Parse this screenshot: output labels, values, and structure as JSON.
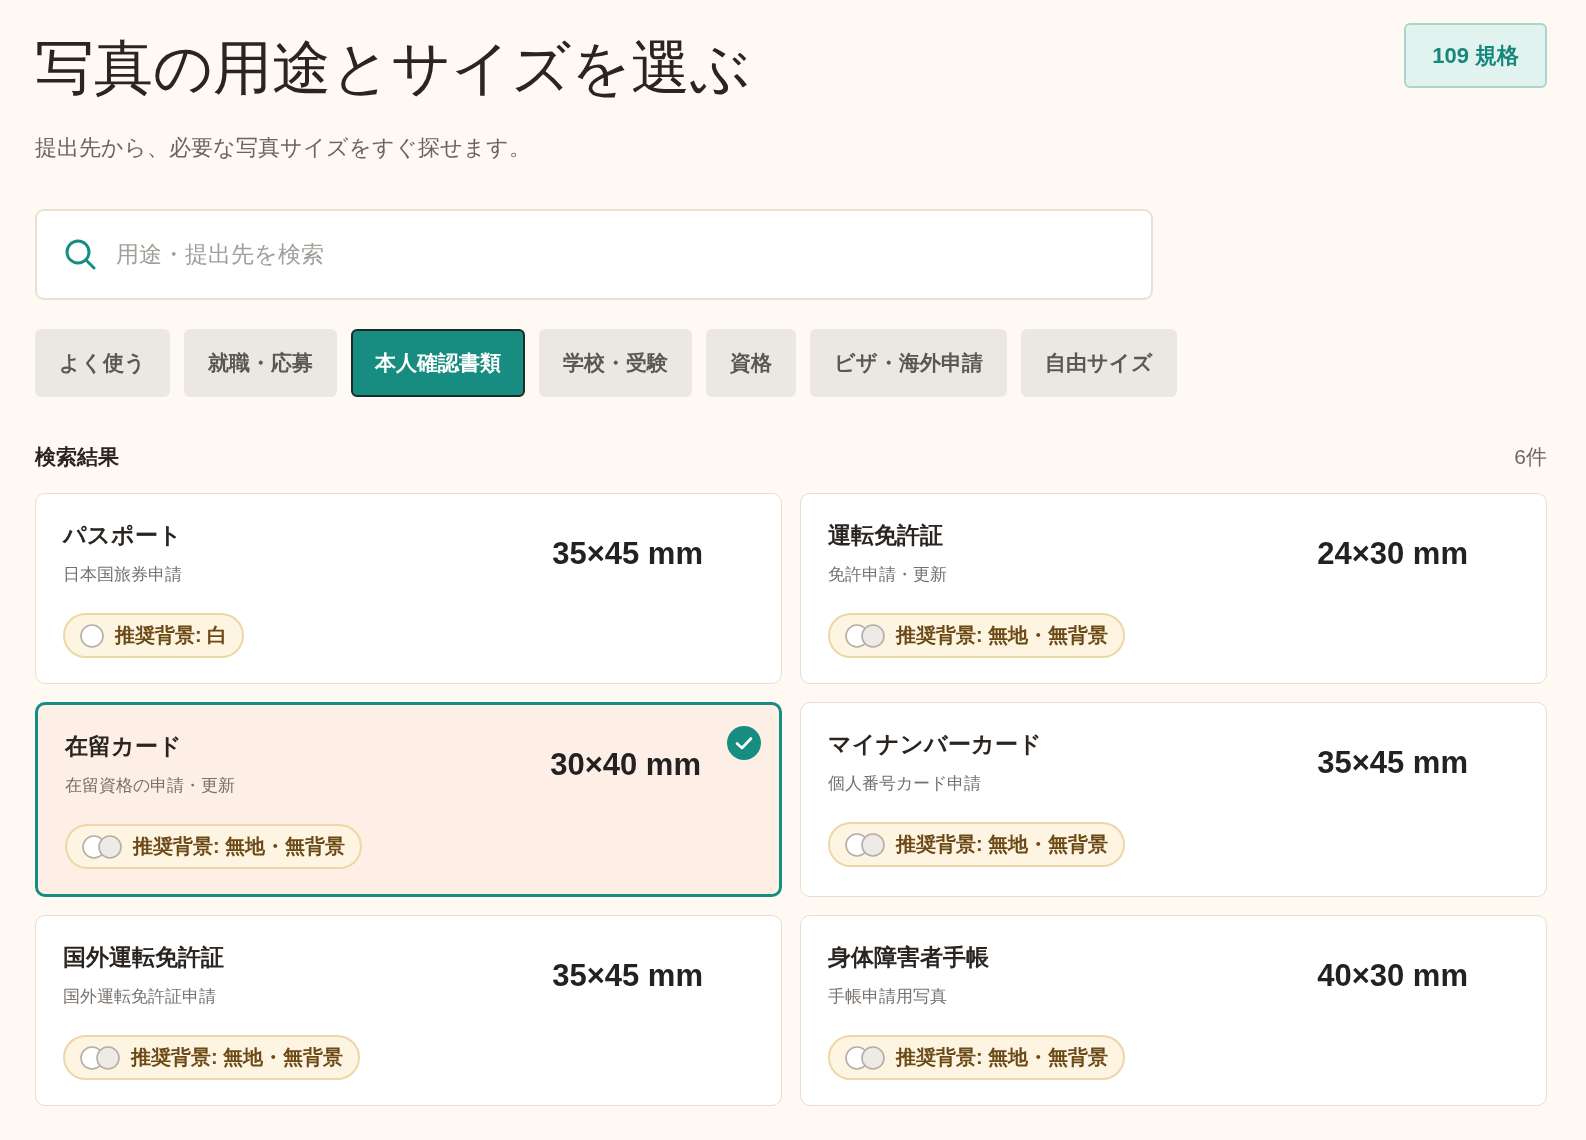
{
  "header": {
    "title": "写真の用途とサイズを選ぶ",
    "subtitle": "提出先から、必要な写真サイズをすぐ探せます。",
    "count_badge": "109 規格"
  },
  "search": {
    "placeholder": "用途・提出先を検索"
  },
  "tabs": [
    {
      "label": "よく使う",
      "selected": false
    },
    {
      "label": "就職・応募",
      "selected": false
    },
    {
      "label": "本人確認書類",
      "selected": true
    },
    {
      "label": "学校・受験",
      "selected": false
    },
    {
      "label": "資格",
      "selected": false
    },
    {
      "label": "ビザ・海外申請",
      "selected": false
    },
    {
      "label": "自由サイズ",
      "selected": false
    }
  ],
  "results": {
    "heading": "検索結果",
    "count": "6件",
    "items": [
      {
        "title": "パスポート",
        "subtitle": "日本国旅券申請",
        "size": "35×45 mm",
        "background": {
          "label": "推奨背景: 白",
          "kind": "white"
        },
        "selected": false
      },
      {
        "title": "運転免許証",
        "subtitle": "免許申請・更新",
        "size": "24×30 mm",
        "background": {
          "label": "推奨背景: 無地・無背景",
          "kind": "plain"
        },
        "selected": false
      },
      {
        "title": "在留カード",
        "subtitle": "在留資格の申請・更新",
        "size": "30×40 mm",
        "background": {
          "label": "推奨背景: 無地・無背景",
          "kind": "plain"
        },
        "selected": true
      },
      {
        "title": "マイナンバーカード",
        "subtitle": "個人番号カード申請",
        "size": "35×45 mm",
        "background": {
          "label": "推奨背景: 無地・無背景",
          "kind": "plain"
        },
        "selected": false
      },
      {
        "title": "国外運転免許証",
        "subtitle": "国外運転免許証申請",
        "size": "35×45 mm",
        "background": {
          "label": "推奨背景: 無地・無背景",
          "kind": "plain"
        },
        "selected": false
      },
      {
        "title": "身体障害者手帳",
        "subtitle": "手帳申請用写真",
        "size": "40×30 mm",
        "background": {
          "label": "推奨背景: 無地・無背景",
          "kind": "plain"
        },
        "selected": false
      }
    ]
  }
}
